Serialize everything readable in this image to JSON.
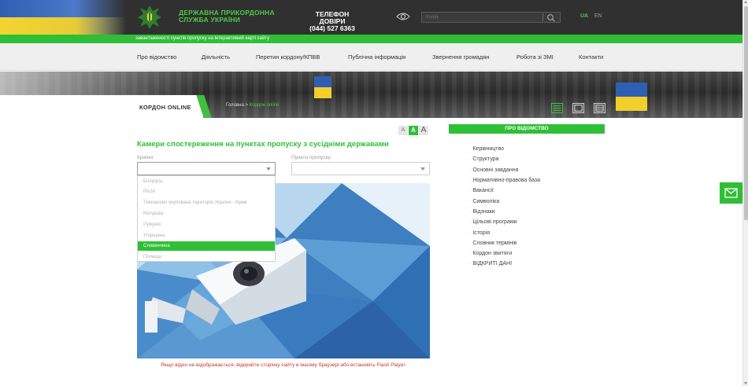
{
  "header": {
    "org_line1": "ДЕРЖАВНА ПРИКОРДОННА",
    "org_line2": "СЛУЖБА УКРАЇНИ",
    "hotline_title": "ТЕЛЕФОН ДОВІРИ",
    "hotline_number": "(044) 527 6363",
    "search_placeholder": "пошук",
    "lang_active": "UA",
    "lang_other": "EN",
    "icons": {
      "emblem": "trident-emblem-icon",
      "eye": "eye-icon",
      "search": "search-icon"
    }
  },
  "ticker": {
    "text": "завантаженості пунктів пропуску на інтерактивній карті сайту"
  },
  "nav": {
    "items": [
      "Про відомство",
      "Діяльність",
      "Перетин кордону/КПВВ",
      "Публічна інформація",
      "Звернення громадян",
      "Робота зі ЗМІ",
      "Контакти"
    ]
  },
  "banner": {
    "section_label": "КОРДОН ONLINE",
    "breadcrumb_home": "Головна",
    "breadcrumb_sep": ">",
    "breadcrumb_current": "Кордон online"
  },
  "content": {
    "font_sizes": [
      "A",
      "A",
      "A"
    ],
    "title": "Камери спостереження на пунктах пропуску з сусідніми державами",
    "countries_label": "Країни:",
    "points_label": "Пункти пропуску:",
    "dropdown_options": [
      "Білорусь",
      "Росія",
      "Тимчасово окупована територія України - Крим",
      "Молдова",
      "Румунія",
      "Угорщина",
      "Словаччина",
      "Польща"
    ],
    "dropdown_highlighted": "Словаччина",
    "flash_note": "Якщо відео не відображається, відкрийте сторінку сайту в іншому браузері або встановіть Flash Player."
  },
  "sidebar": {
    "heading": "ПРО ВІДОМСТВО",
    "items": [
      "Керівництво",
      "Структура",
      "Основні завдання",
      "Нормативно-правова база",
      "Вакансії",
      "Символіка",
      "Відзнаки",
      "Цільові програми",
      "Історія",
      "Словник термінів",
      "Кордон звитяги",
      "ВІДКРИТІ ДАНІ"
    ]
  },
  "colors": {
    "accent": "#2fbf36",
    "header_bg": "#303030",
    "nav_bg": "#efefef",
    "note_red": "#c0392b"
  }
}
